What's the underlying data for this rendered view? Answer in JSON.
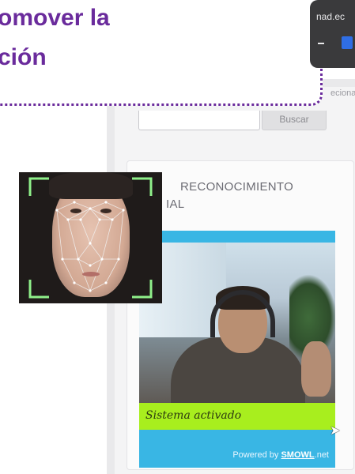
{
  "headline": {
    "line1": "omover la",
    "line2": "ción"
  },
  "browser": {
    "url_fragment": "nad.ec"
  },
  "nav": {
    "partial_label": "eciona"
  },
  "search": {
    "placeholder": "",
    "button_label": "Buscar"
  },
  "card": {
    "title_line1": "RECONOCIMIENTO",
    "title_line2": "IAL"
  },
  "video": {
    "status_text": "Sistema activado",
    "powered_prefix": "Powered by ",
    "powered_brand": "SMOWL",
    "powered_suffix": ".net"
  },
  "colors": {
    "accent_purple": "#6a2b9c",
    "widget_blue": "#39b6e4",
    "status_green": "#a8ee1e",
    "grid_green": "#8ff08a"
  },
  "icons": {
    "face": "face-mesh-image",
    "cursor": "mouse-pointer-icon"
  }
}
